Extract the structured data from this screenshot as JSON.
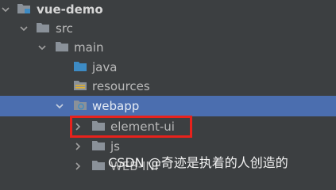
{
  "tree": {
    "items": [
      {
        "label": "vue-demo",
        "icon": "module-folder-icon",
        "expanded": true
      },
      {
        "label": "src",
        "icon": "folder-icon",
        "expanded": true
      },
      {
        "label": "main",
        "icon": "folder-icon",
        "expanded": true
      },
      {
        "label": "java",
        "icon": "source-folder-icon"
      },
      {
        "label": "resources",
        "icon": "resources-folder-icon"
      },
      {
        "label": "webapp",
        "icon": "web-folder-icon",
        "expanded": true,
        "selected": true
      },
      {
        "label": "element-ui",
        "icon": "folder-icon",
        "expanded": false,
        "highlighted": true
      },
      {
        "label": "js",
        "icon": "folder-icon",
        "expanded": false
      },
      {
        "label": "WEB-INF",
        "icon": "folder-icon",
        "expanded": false
      }
    ]
  },
  "watermark": "CSDN @奇迹是执着的人创造的",
  "colors": {
    "background": "#3c3f41",
    "selection": "#4b6eaf",
    "folder": "#8a9199",
    "source_folder": "#3d8bc4",
    "highlight_border": "#e8221c"
  }
}
